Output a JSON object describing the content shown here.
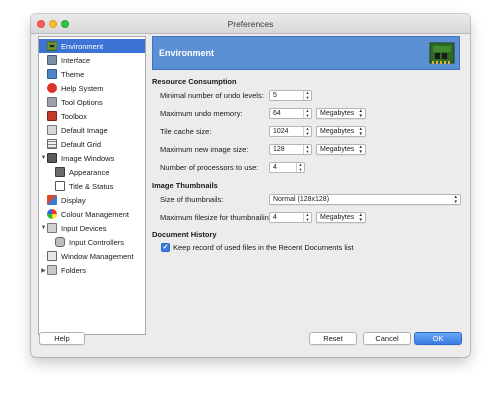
{
  "window": {
    "title": "Preferences"
  },
  "sidebar": {
    "items": [
      {
        "label": "Environment",
        "icon": "environment-chip-icon",
        "selected": true
      },
      {
        "label": "Interface",
        "icon": "interface-icon"
      },
      {
        "label": "Theme",
        "icon": "theme-icon"
      },
      {
        "label": "Help System",
        "icon": "help-system-icon"
      },
      {
        "label": "Tool Options",
        "icon": "tool-options-icon"
      },
      {
        "label": "Toolbox",
        "icon": "toolbox-icon"
      },
      {
        "label": "Default Image",
        "icon": "default-image-icon"
      },
      {
        "label": "Default Grid",
        "icon": "default-grid-icon"
      },
      {
        "label": "Image Windows",
        "icon": "image-windows-icon",
        "expanded": true
      },
      {
        "label": "Appearance",
        "icon": "appearance-icon"
      },
      {
        "label": "Title & Status",
        "icon": "title-status-icon"
      },
      {
        "label": "Display",
        "icon": "display-icon"
      },
      {
        "label": "Colour Management",
        "icon": "colour-management-icon"
      },
      {
        "label": "Input Devices",
        "icon": "input-devices-icon",
        "expanded": true
      },
      {
        "label": "Input Controllers",
        "icon": "input-controllers-icon"
      },
      {
        "label": "Window Management",
        "icon": "window-management-icon"
      },
      {
        "label": "Folders",
        "icon": "folders-icon",
        "expanded": false
      }
    ]
  },
  "header": {
    "title": "Environment"
  },
  "resource": {
    "title": "Resource Consumption",
    "undo_levels_label": "Minimal number of undo levels:",
    "undo_levels_value": "5",
    "undo_memory_label": "Maximum undo memory:",
    "undo_memory_value": "64",
    "undo_memory_unit": "Megabytes",
    "tile_cache_label": "Tile cache size:",
    "tile_cache_value": "1024",
    "tile_cache_unit": "Megabytes",
    "max_image_label": "Maximum new image size:",
    "max_image_value": "128",
    "max_image_unit": "Megabytes",
    "processors_label": "Number of processors to use:",
    "processors_value": "4"
  },
  "thumbnails": {
    "title": "Image Thumbnails",
    "size_label": "Size of thumbnails:",
    "size_value": "Normal (128x128)",
    "filesize_label": "Maximum filesize for thumbnailing:",
    "filesize_value": "4",
    "filesize_unit": "Megabytes"
  },
  "history": {
    "title": "Document History",
    "keep_record_label": "Keep record of used files in the Recent Documents list",
    "keep_record_checked": true
  },
  "buttons": {
    "help": "Help",
    "reset": "Reset",
    "cancel": "Cancel",
    "ok": "OK"
  },
  "colors": {
    "accent": "#3b74d4",
    "header": "#5a8fd3",
    "window_bg": "#ececec"
  }
}
